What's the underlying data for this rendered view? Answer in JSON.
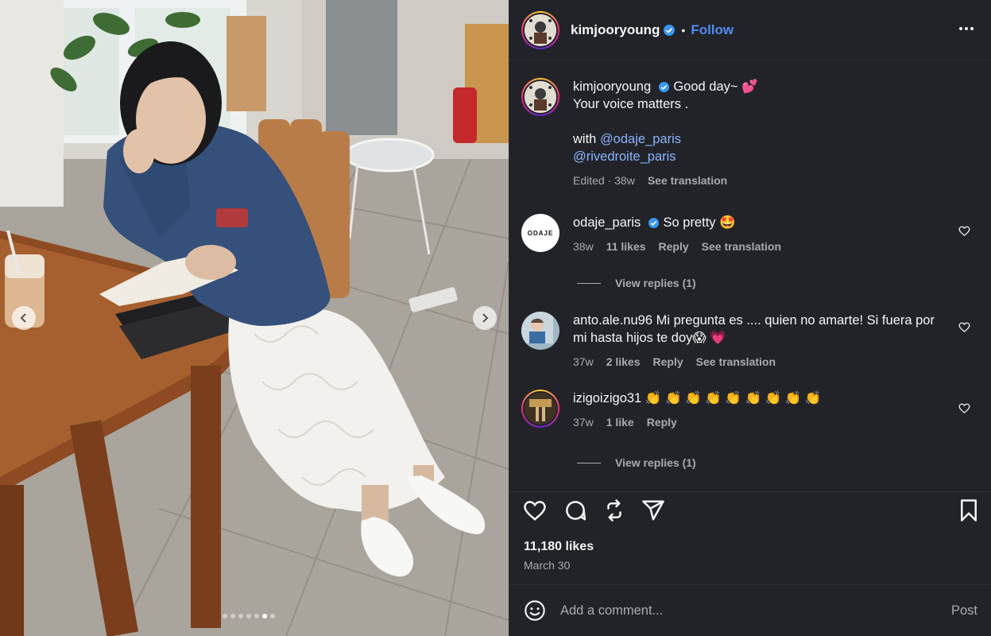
{
  "post": {
    "author": "kimjooryoung",
    "follow_label": "Follow",
    "separator": "•",
    "photo_count": 7,
    "active_photo": 6
  },
  "caption": {
    "user": "kimjooryoung",
    "line1": "Good day~ 💕",
    "line2": "Your voice matters .",
    "with_label": "with",
    "mention1": "@odaje_paris",
    "mention2": "@rivedroite_paris",
    "edited": "Edited · 38w",
    "see_translation": "See translation"
  },
  "comments": [
    {
      "user": "odaje_paris",
      "verified": true,
      "avatar_text": "ODAJE",
      "text": "So pretty 🤩",
      "time": "38w",
      "likes": "11 likes",
      "reply": "Reply",
      "see_translation": "See translation",
      "view_replies": "View replies (1)"
    },
    {
      "user": "anto.ale.nu96",
      "text": "Mi pregunta es .... quien no amarte! Si fuera por mi hasta hijos te doy😱 💗",
      "time": "37w",
      "likes": "2 likes",
      "reply": "Reply",
      "see_translation": "See translation"
    },
    {
      "user": "izigoizigo31",
      "text": "👏 👏 👏 👏 👏 👏 👏 👏 👏",
      "time": "37w",
      "likes": "1 like",
      "reply": "Reply",
      "view_replies": "View replies (1)"
    }
  ],
  "stats": {
    "likes": "11,180 likes",
    "date": "March 30"
  },
  "composer": {
    "placeholder": "Add a comment...",
    "post_label": "Post"
  },
  "colors": {
    "panel_bg": "#212328",
    "link_blue": "#4f8cf5",
    "mention": "#8ab4ff",
    "muted": "#a8abb1",
    "verified_blue": "#3897f0"
  },
  "icons": [
    "verified-icon",
    "more-icon",
    "heart-icon",
    "comment-icon",
    "repost-icon",
    "share-icon",
    "bookmark-icon",
    "emoji-icon",
    "chevron-left-icon",
    "chevron-right-icon"
  ]
}
